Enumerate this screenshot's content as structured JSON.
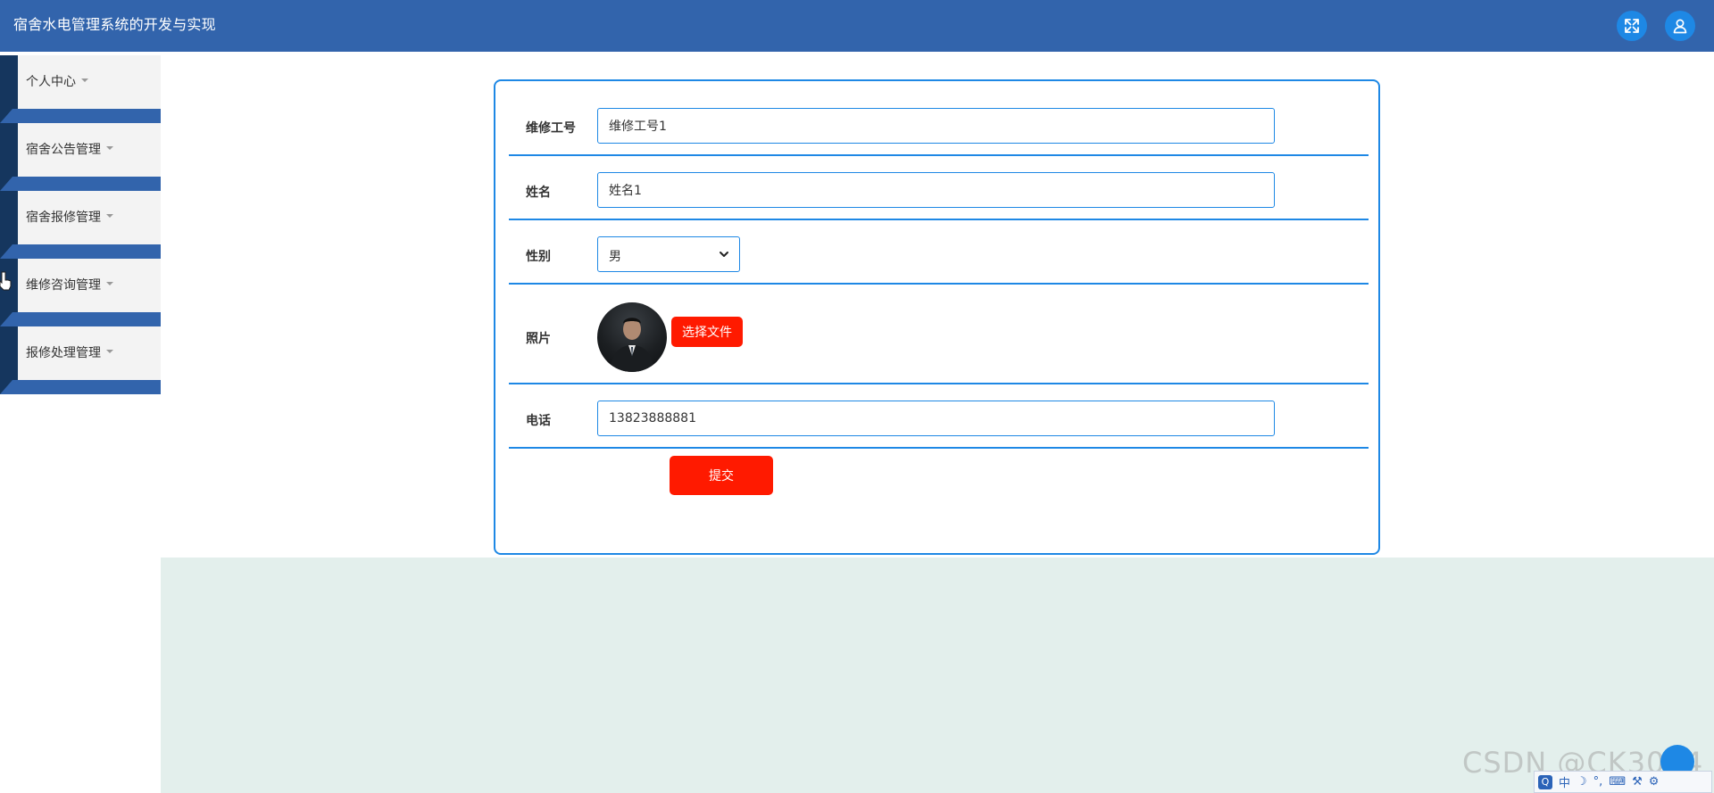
{
  "header": {
    "title": "宿舍水电管理系统的开发与实现",
    "fullscreen_icon": "expand-arrows-icon",
    "user_icon": "user-icon"
  },
  "sidebar": {
    "items": [
      {
        "label": "个人中心"
      },
      {
        "label": "宿舍公告管理"
      },
      {
        "label": "宿舍报修管理"
      },
      {
        "label": "维修咨询管理"
      },
      {
        "label": "报修处理管理"
      }
    ]
  },
  "form": {
    "worker_id": {
      "label": "维修工号",
      "value": "维修工号1"
    },
    "name": {
      "label": "姓名",
      "value": "姓名1"
    },
    "gender": {
      "label": "性别",
      "value": "男"
    },
    "photo": {
      "label": "照片",
      "button": "选择文件"
    },
    "phone": {
      "label": "电话",
      "value": "13823888881"
    },
    "submit": "提交"
  },
  "colors": {
    "header_bg": "#3264ac",
    "accent_blue": "#1e88e5",
    "button_red": "#ff1a00",
    "content_bg": "#e3efec"
  },
  "overlay": {
    "watermark": "CSDN @CK3084",
    "ime_mode": "中"
  }
}
